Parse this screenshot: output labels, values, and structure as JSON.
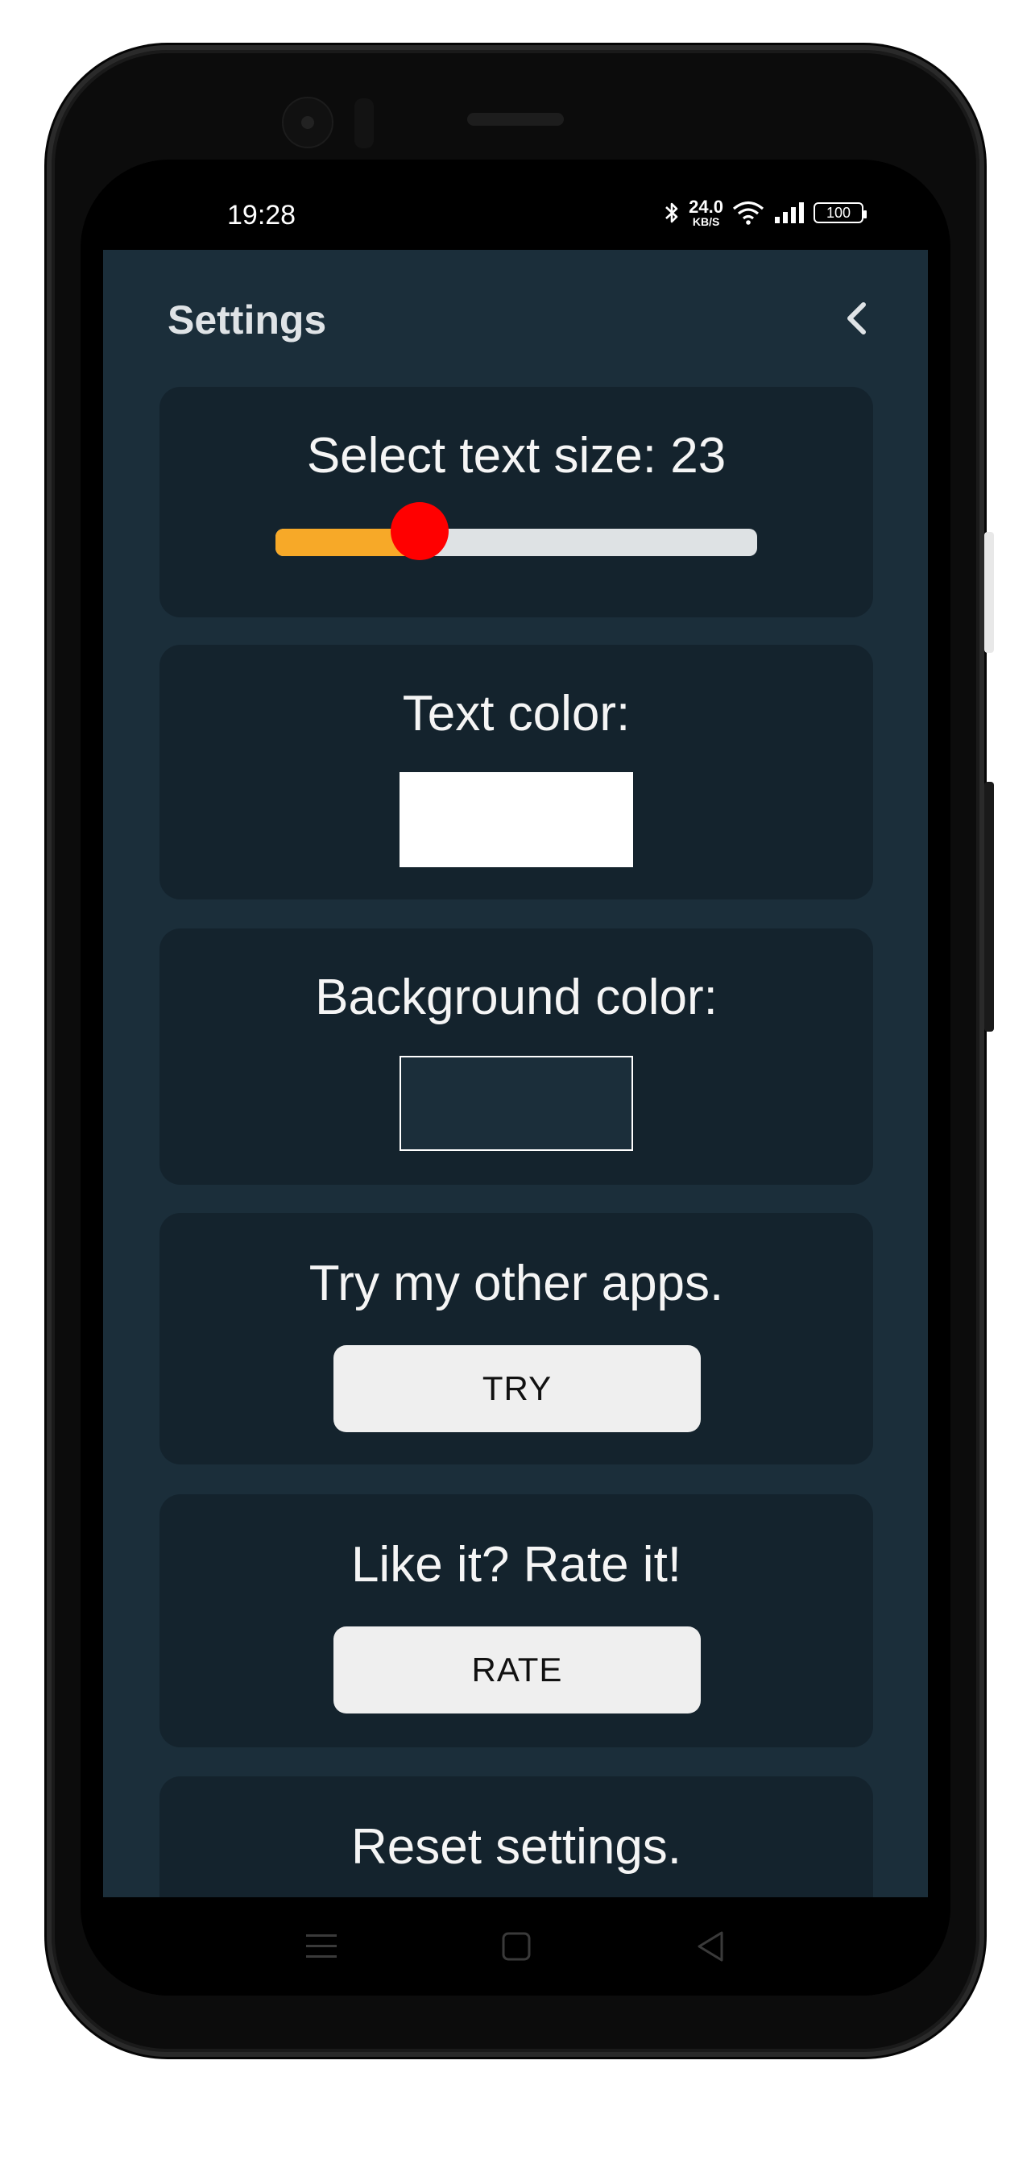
{
  "status_bar": {
    "time": "19:28",
    "net_speed_value": "24.0",
    "net_speed_unit": "KB/S",
    "battery": "100",
    "icons": [
      "bluetooth-icon",
      "wifi-icon",
      "signal-icon",
      "battery-icon"
    ]
  },
  "header": {
    "title": "Settings",
    "back_icon": "chevron-left-icon"
  },
  "text_size": {
    "label": "Select text size: 23",
    "value": 23,
    "slider_fraction": 0.3
  },
  "text_color": {
    "label": "Text color:",
    "swatch_color": "#ffffff"
  },
  "background_color": {
    "label": "Background color:",
    "swatch_color": "#1b2e3a"
  },
  "other_apps": {
    "label": "Try my other apps.",
    "button_label": "TRY"
  },
  "rate": {
    "label": "Like it? Rate it!",
    "button_label": "RATE"
  },
  "reset": {
    "label": "Reset settings."
  },
  "colors": {
    "screen_background": "#1b2e3a",
    "card_background": "#14232d",
    "slider_fill": "#f7a928",
    "slider_thumb": "#ff0000",
    "slider_track": "#dee2e4",
    "button_background": "#efefef"
  },
  "nav_bar": {
    "icons": [
      "menu-icon",
      "home-icon",
      "back-triangle-icon"
    ]
  }
}
